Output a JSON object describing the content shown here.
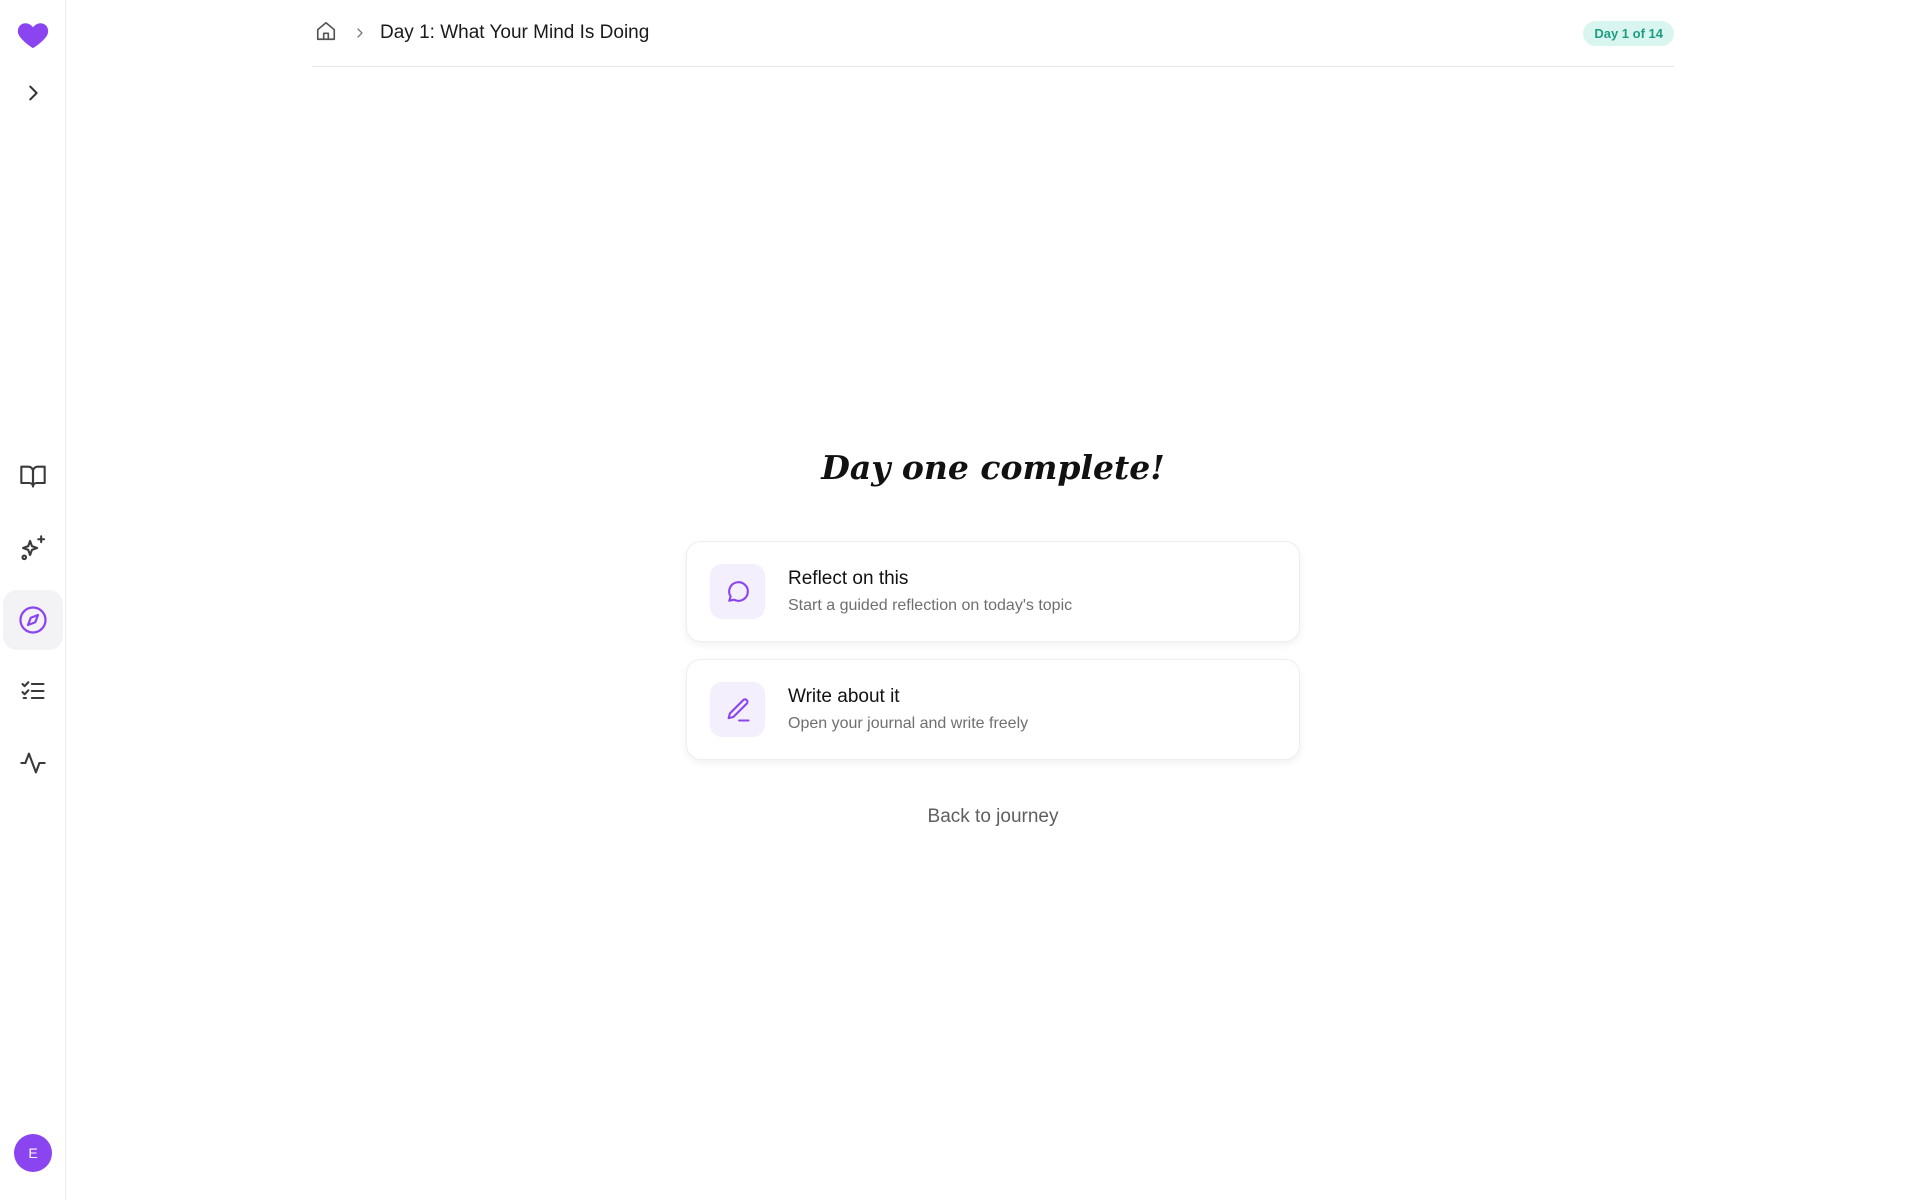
{
  "sidebar": {
    "logo_icon": "heart-icon",
    "expand_icon": "chevron-right-icon",
    "items": [
      {
        "name": "journal",
        "icon": "book-open-icon",
        "active": false
      },
      {
        "name": "sparkles",
        "icon": "sparkles-icon",
        "active": false
      },
      {
        "name": "explore",
        "icon": "compass-icon",
        "active": true
      },
      {
        "name": "tasks",
        "icon": "list-checks-icon",
        "active": false
      },
      {
        "name": "activity",
        "icon": "activity-icon",
        "active": false
      }
    ],
    "avatar_initial": "E"
  },
  "header": {
    "home_icon": "home-icon",
    "title": "Day 1: What Your Mind Is Doing",
    "badge": "Day 1 of 14"
  },
  "main": {
    "heading": "Day one complete!",
    "cards": [
      {
        "title": "Reflect on this",
        "subtitle": "Start a guided reflection on today's topic",
        "icon": "message-circle-icon"
      },
      {
        "title": "Write about it",
        "subtitle": "Open your journal and write freely",
        "icon": "pen-icon"
      }
    ],
    "back_link": "Back to journey"
  },
  "colors": {
    "accent": "#8b45f0",
    "badge_bg": "#d9f5ef",
    "badge_text": "#1f9d84",
    "icon_tile_bg": "#f3effc"
  }
}
